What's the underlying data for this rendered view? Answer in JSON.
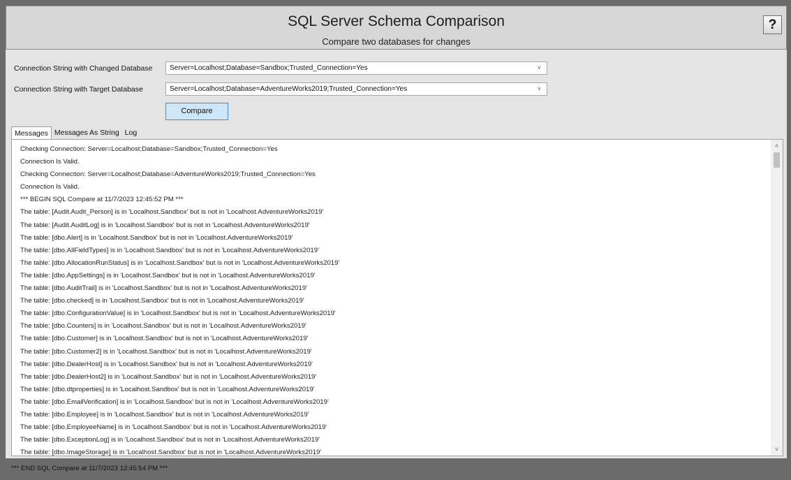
{
  "header": {
    "title": "SQL Server Schema Comparison",
    "subtitle": "Compare two databases for changes",
    "help_label": "?"
  },
  "form": {
    "changed_label": "Connection String with Changed Database",
    "changed_value": "Server=Localhost;Database=Sandbox;Trusted_Connection=Yes",
    "target_label": "Connection String with Target Database",
    "target_value": "Server=Localhost;Database=AdventureWorks2019;Trusted_Connection=Yes",
    "dropdown_arrow": "˅",
    "compare_label": "Compare"
  },
  "tabs": [
    "Messages",
    "Messages As String",
    "Log"
  ],
  "messages": [
    "Checking Connection: Server=Localhost;Database=Sandbox;Trusted_Connection=Yes",
    "Connection Is Valid.",
    "Checking Connection: Server=Localhost;Database=AdventureWorks2019;Trusted_Connection=Yes",
    "Connection Is Valid.",
    "*** BEGIN SQL Compare at 11/7/2023 12:45:52 PM ***",
    "The table: [Audit.Audit_Person] is in 'Localhost.Sandbox' but is not in 'Localhost.AdventureWorks2019'",
    "The table: [Audit.AuditLog] is in 'Localhost.Sandbox' but is not in 'Localhost.AdventureWorks2019'",
    "The table: [dbo.Alert] is in 'Localhost.Sandbox' but is not in 'Localhost.AdventureWorks2019'",
    "The table: [dbo.AllFieldTypes] is in 'Localhost.Sandbox' but is not in 'Localhost.AdventureWorks2019'",
    "The table: [dbo.AllocationRunStatus] is in 'Localhost.Sandbox' but is not in 'Localhost.AdventureWorks2019'",
    "The table: [dbo.AppSettings] is in 'Localhost.Sandbox' but is not in 'Localhost.AdventureWorks2019'",
    "The table: [dbo.AuditTrail] is in 'Localhost.Sandbox' but is not in 'Localhost.AdventureWorks2019'",
    "The table: [dbo.checked] is in 'Localhost.Sandbox' but is not in 'Localhost.AdventureWorks2019'",
    "The table: [dbo.ConfigurationValue] is in 'Localhost.Sandbox' but is not in 'Localhost.AdventureWorks2019'",
    "The table: [dbo.Counters] is in 'Localhost.Sandbox' but is not in 'Localhost.AdventureWorks2019'",
    "The table: [dbo.Customer] is in 'Localhost.Sandbox' but is not in 'Localhost.AdventureWorks2019'",
    "The table: [dbo.Customer2] is in 'Localhost.Sandbox' but is not in 'Localhost.AdventureWorks2019'",
    "The table: [dbo.DealerHost] is in 'Localhost.Sandbox' but is not in 'Localhost.AdventureWorks2019'",
    "The table: [dbo.DealerHost2] is in 'Localhost.Sandbox' but is not in 'Localhost.AdventureWorks2019'",
    "The table: [dbo.dtproperties] is in 'Localhost.Sandbox' but is not in 'Localhost.AdventureWorks2019'",
    "The table: [dbo.EmailVerification] is in 'Localhost.Sandbox' but is not in 'Localhost.AdventureWorks2019'",
    "The table: [dbo.Employee] is in 'Localhost.Sandbox' but is not in 'Localhost.AdventureWorks2019'",
    "The table: [dbo.EmployeeName] is in 'Localhost.Sandbox' but is not in 'Localhost.AdventureWorks2019'",
    "The table: [dbo.ExceptionLog] is in 'Localhost.Sandbox' but is not in 'Localhost.AdventureWorks2019'",
    "The table: [dbo.ImageStorage] is in 'Localhost.Sandbox' but is not in 'Localhost.AdventureWorks2019'"
  ],
  "scrollbar": {
    "up_arrow": "˄",
    "down_arrow": "˅"
  },
  "status": "*** END SQL Compare at 11/7/2023 12:45:54 PM ***"
}
